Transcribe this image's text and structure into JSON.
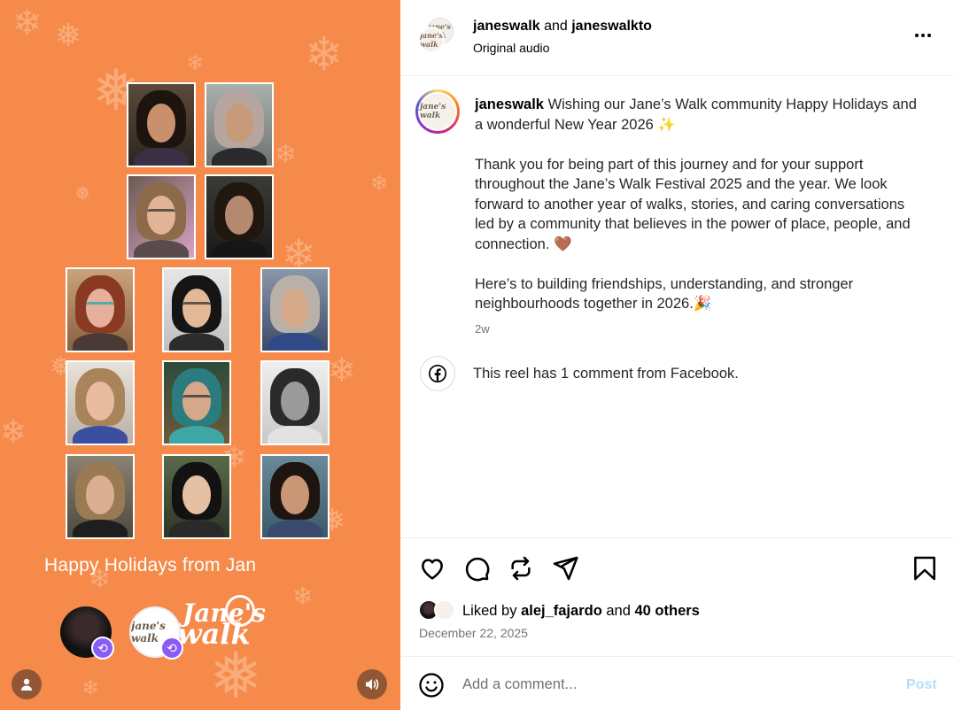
{
  "reel": {
    "caption": "Happy Holidays from Jan",
    "logo_line1": "Jane's",
    "logo_line2": "walk",
    "avatar2_text": "jane's walk",
    "profile_icon": "person-icon",
    "mute_icon": "speaker-icon",
    "repost_icon": "repost-icon",
    "background_color": "#f58a4b"
  },
  "header": {
    "user1": "janeswalk",
    "joiner": "and",
    "user2": "janeswalkto",
    "audio": "Original audio",
    "avatar_text": "jane's walk",
    "more_icon": "more-icon"
  },
  "caption": {
    "username": "janeswalk",
    "line1": "Wishing our Jane’s Walk community Happy Holidays and a wonderful New Year 2026 ✨",
    "para2": "Thank you for being part of this journey and for your support throughout the Jane’s Walk Festival 2025 and the year. We look forward to another year of walks, stories, and caring conversations led by a community that believes in the power of place, people, and connection. 🤎",
    "para3": "Here’s to building friendships, understanding, and stronger neighbourhoods together in 2026.🎉",
    "time": "2w",
    "avatar_text": "jane's walk"
  },
  "facebook": {
    "text": "This reel has 1 comment from Facebook.",
    "icon": "facebook-icon"
  },
  "actions": {
    "icons": [
      "heart-icon",
      "comment-icon",
      "repost-icon",
      "share-icon",
      "bookmark-icon"
    ]
  },
  "likes": {
    "prefix": "Liked by",
    "user": "alej_fajardo",
    "joiner": "and",
    "others": "40 others"
  },
  "date": "December 22, 2025",
  "comment": {
    "placeholder": "Add a comment...",
    "post_label": "Post",
    "emoji_icon": "emoji-icon"
  }
}
